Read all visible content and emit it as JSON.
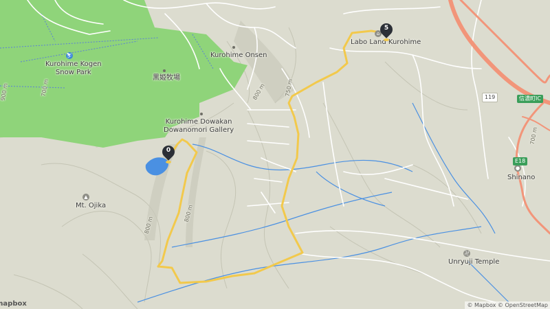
{
  "map": {
    "colors": {
      "land": "#dcdccf",
      "park": "#8fd47a",
      "water": "#4a90e2",
      "route": "#f2c94c",
      "road": "#ffffff",
      "highway": "#f2957a",
      "contour": "#c4c4b4"
    },
    "place_labels": {
      "snow_park_line1": "Kurohime Kogen",
      "snow_park_line2": "Snow Park",
      "ranch": "黒姫牧場",
      "onsen": "Kurohime Onsen",
      "gallery_line1": "Kurohime Dowakan",
      "gallery_line2": "Dowanomori Gallery",
      "labo_land": "Labo Land Kurohime",
      "mt_ojika": "Mt. Ojika",
      "shinano": "Shinano",
      "unryuji": "Unryuji Temple"
    },
    "contour_labels": {
      "c1": "800 m",
      "c2": "800 m",
      "c3": "800 m",
      "c4": "750 m",
      "c5": "900 m",
      "c6": "700 m",
      "c7": "700 m"
    },
    "road_shields": {
      "r119": "119",
      "ic": "信濃町IC",
      "e18": "E18"
    },
    "markers": [
      {
        "label": "0",
        "name": "start"
      },
      {
        "label": "5",
        "name": "end"
      }
    ],
    "icons": {
      "snow_park": "ski-icon",
      "gallery": "poi-dot-icon",
      "ranch": "poi-dot-icon",
      "onsen": "poi-dot-icon",
      "labo_land": "lodging-icon",
      "mt_ojika": "mountain-icon",
      "shinano": "town-icon",
      "unryuji": "temple-icon",
      "route_marker": "map-pin-icon"
    },
    "attribution": "© Mapbox © OpenStreetMap",
    "logo": "mapbox"
  }
}
